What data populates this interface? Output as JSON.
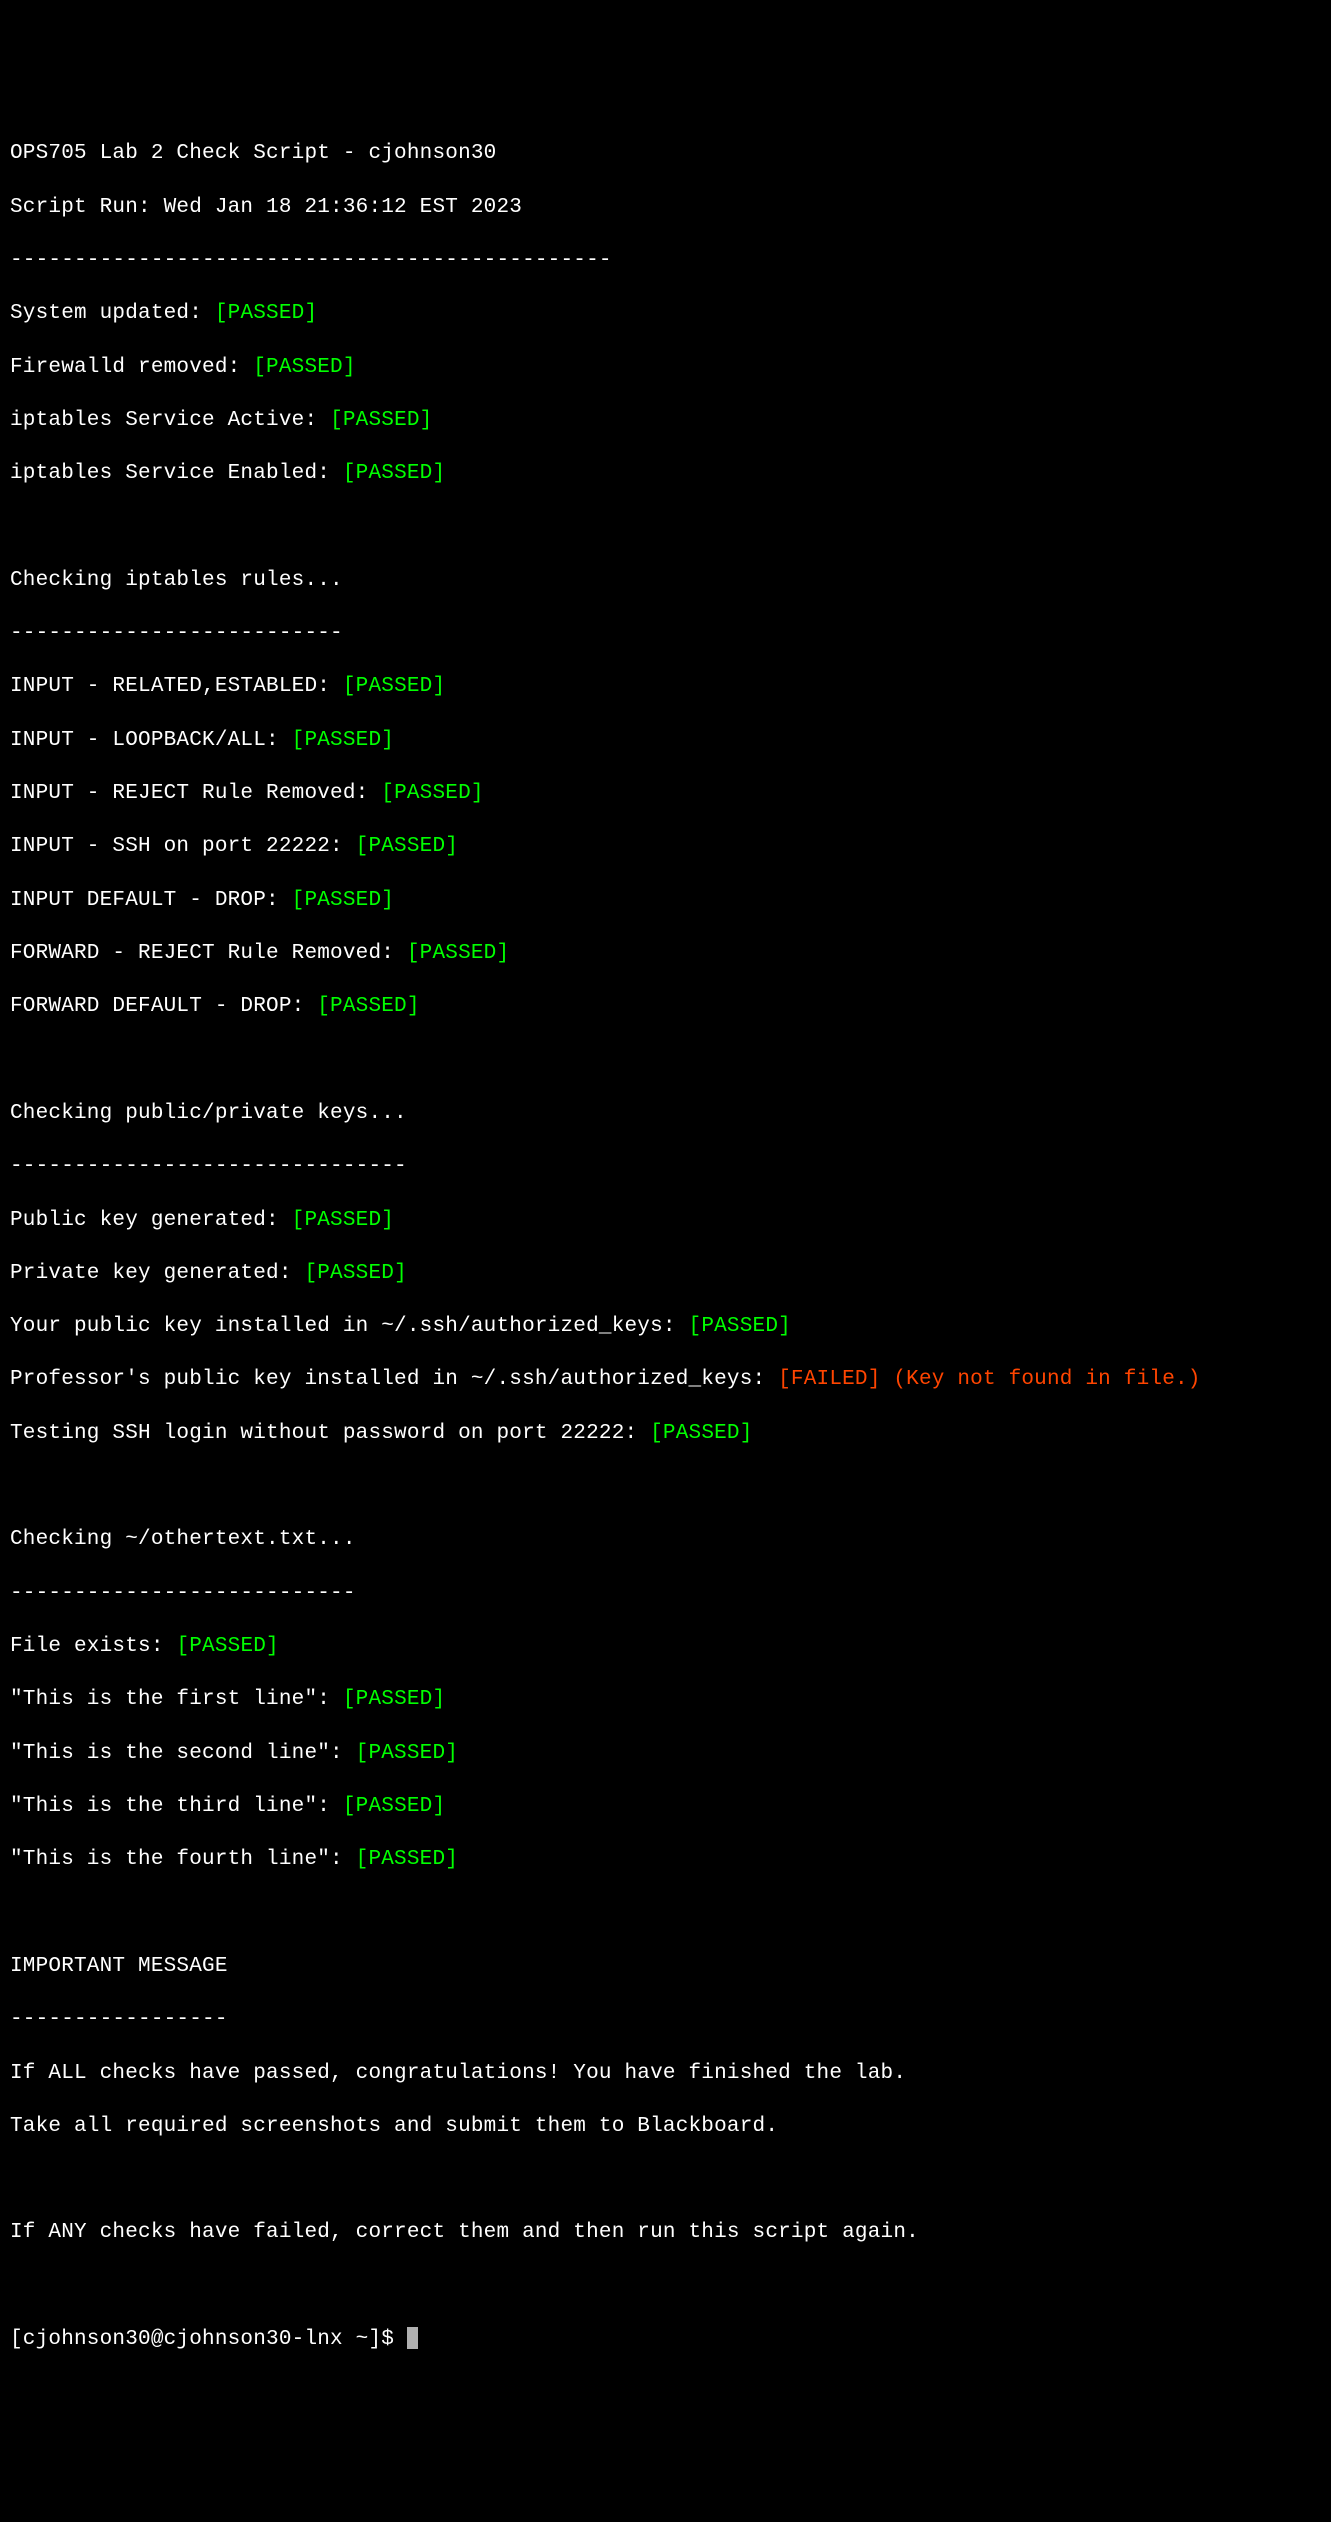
{
  "header": {
    "title_line": "OPS705 Lab 2 Check Script - cjohnson30",
    "script_run_line": "Script Run: Wed Jan 18 21:36:12 EST 2023",
    "divider": "-----------------------------------------------"
  },
  "system_checks": [
    {
      "label": "System updated: ",
      "status": "[PASSED]",
      "pass": true
    },
    {
      "label": "Firewalld removed: ",
      "status": "[PASSED]",
      "pass": true
    },
    {
      "label": "iptables Service Active: ",
      "status": "[PASSED]",
      "pass": true
    },
    {
      "label": "iptables Service Enabled: ",
      "status": "[PASSED]",
      "pass": true
    }
  ],
  "iptables_section": {
    "heading": "Checking iptables rules...",
    "divider": "--------------------------",
    "checks": [
      {
        "label": "INPUT - RELATED,ESTABLED: ",
        "status": "[PASSED]",
        "pass": true
      },
      {
        "label": "INPUT - LOOPBACK/ALL: ",
        "status": "[PASSED]",
        "pass": true
      },
      {
        "label": "INPUT - REJECT Rule Removed: ",
        "status": "[PASSED]",
        "pass": true
      },
      {
        "label": "INPUT - SSH on port 22222: ",
        "status": "[PASSED]",
        "pass": true
      },
      {
        "label": "INPUT DEFAULT - DROP: ",
        "status": "[PASSED]",
        "pass": true
      },
      {
        "label": "FORWARD - REJECT Rule Removed: ",
        "status": "[PASSED]",
        "pass": true
      },
      {
        "label": "FORWARD DEFAULT - DROP: ",
        "status": "[PASSED]",
        "pass": true
      }
    ]
  },
  "keys_section": {
    "heading": "Checking public/private keys...",
    "divider": "-------------------------------",
    "checks": [
      {
        "label": "Public key generated: ",
        "status": "[PASSED]",
        "pass": true,
        "extra": ""
      },
      {
        "label": "Private key generated: ",
        "status": "[PASSED]",
        "pass": true,
        "extra": ""
      },
      {
        "label": "Your public key installed in ~/.ssh/authorized_keys: ",
        "status": "[PASSED]",
        "pass": true,
        "extra": ""
      },
      {
        "label": "Professor's public key installed in ~/.ssh/authorized_keys: ",
        "status": "[FAILED]",
        "pass": false,
        "extra": " (Key not found in file.)"
      },
      {
        "label": "Testing SSH login without password on port 22222: ",
        "status": "[PASSED]",
        "pass": true,
        "extra": ""
      }
    ]
  },
  "othertext_section": {
    "heading": "Checking ~/othertext.txt...",
    "divider": "---------------------------",
    "checks": [
      {
        "label": "File exists: ",
        "status": "[PASSED]",
        "pass": true
      },
      {
        "label": "\"This is the first line\": ",
        "status": "[PASSED]",
        "pass": true
      },
      {
        "label": "\"This is the second line\": ",
        "status": "[PASSED]",
        "pass": true
      },
      {
        "label": "\"This is the third line\": ",
        "status": "[PASSED]",
        "pass": true
      },
      {
        "label": "\"This is the fourth line\": ",
        "status": "[PASSED]",
        "pass": true
      }
    ]
  },
  "message_section": {
    "heading": "IMPORTANT MESSAGE",
    "divider": "-----------------",
    "msg1": "If ALL checks have passed, congratulations! You have finished the lab.",
    "msg2": "Take all required screenshots and submit them to Blackboard.",
    "msg3": "If ANY checks have failed, correct them and then run this script again."
  },
  "prompt": "[cjohnson30@cjohnson30-lnx ~]$ "
}
